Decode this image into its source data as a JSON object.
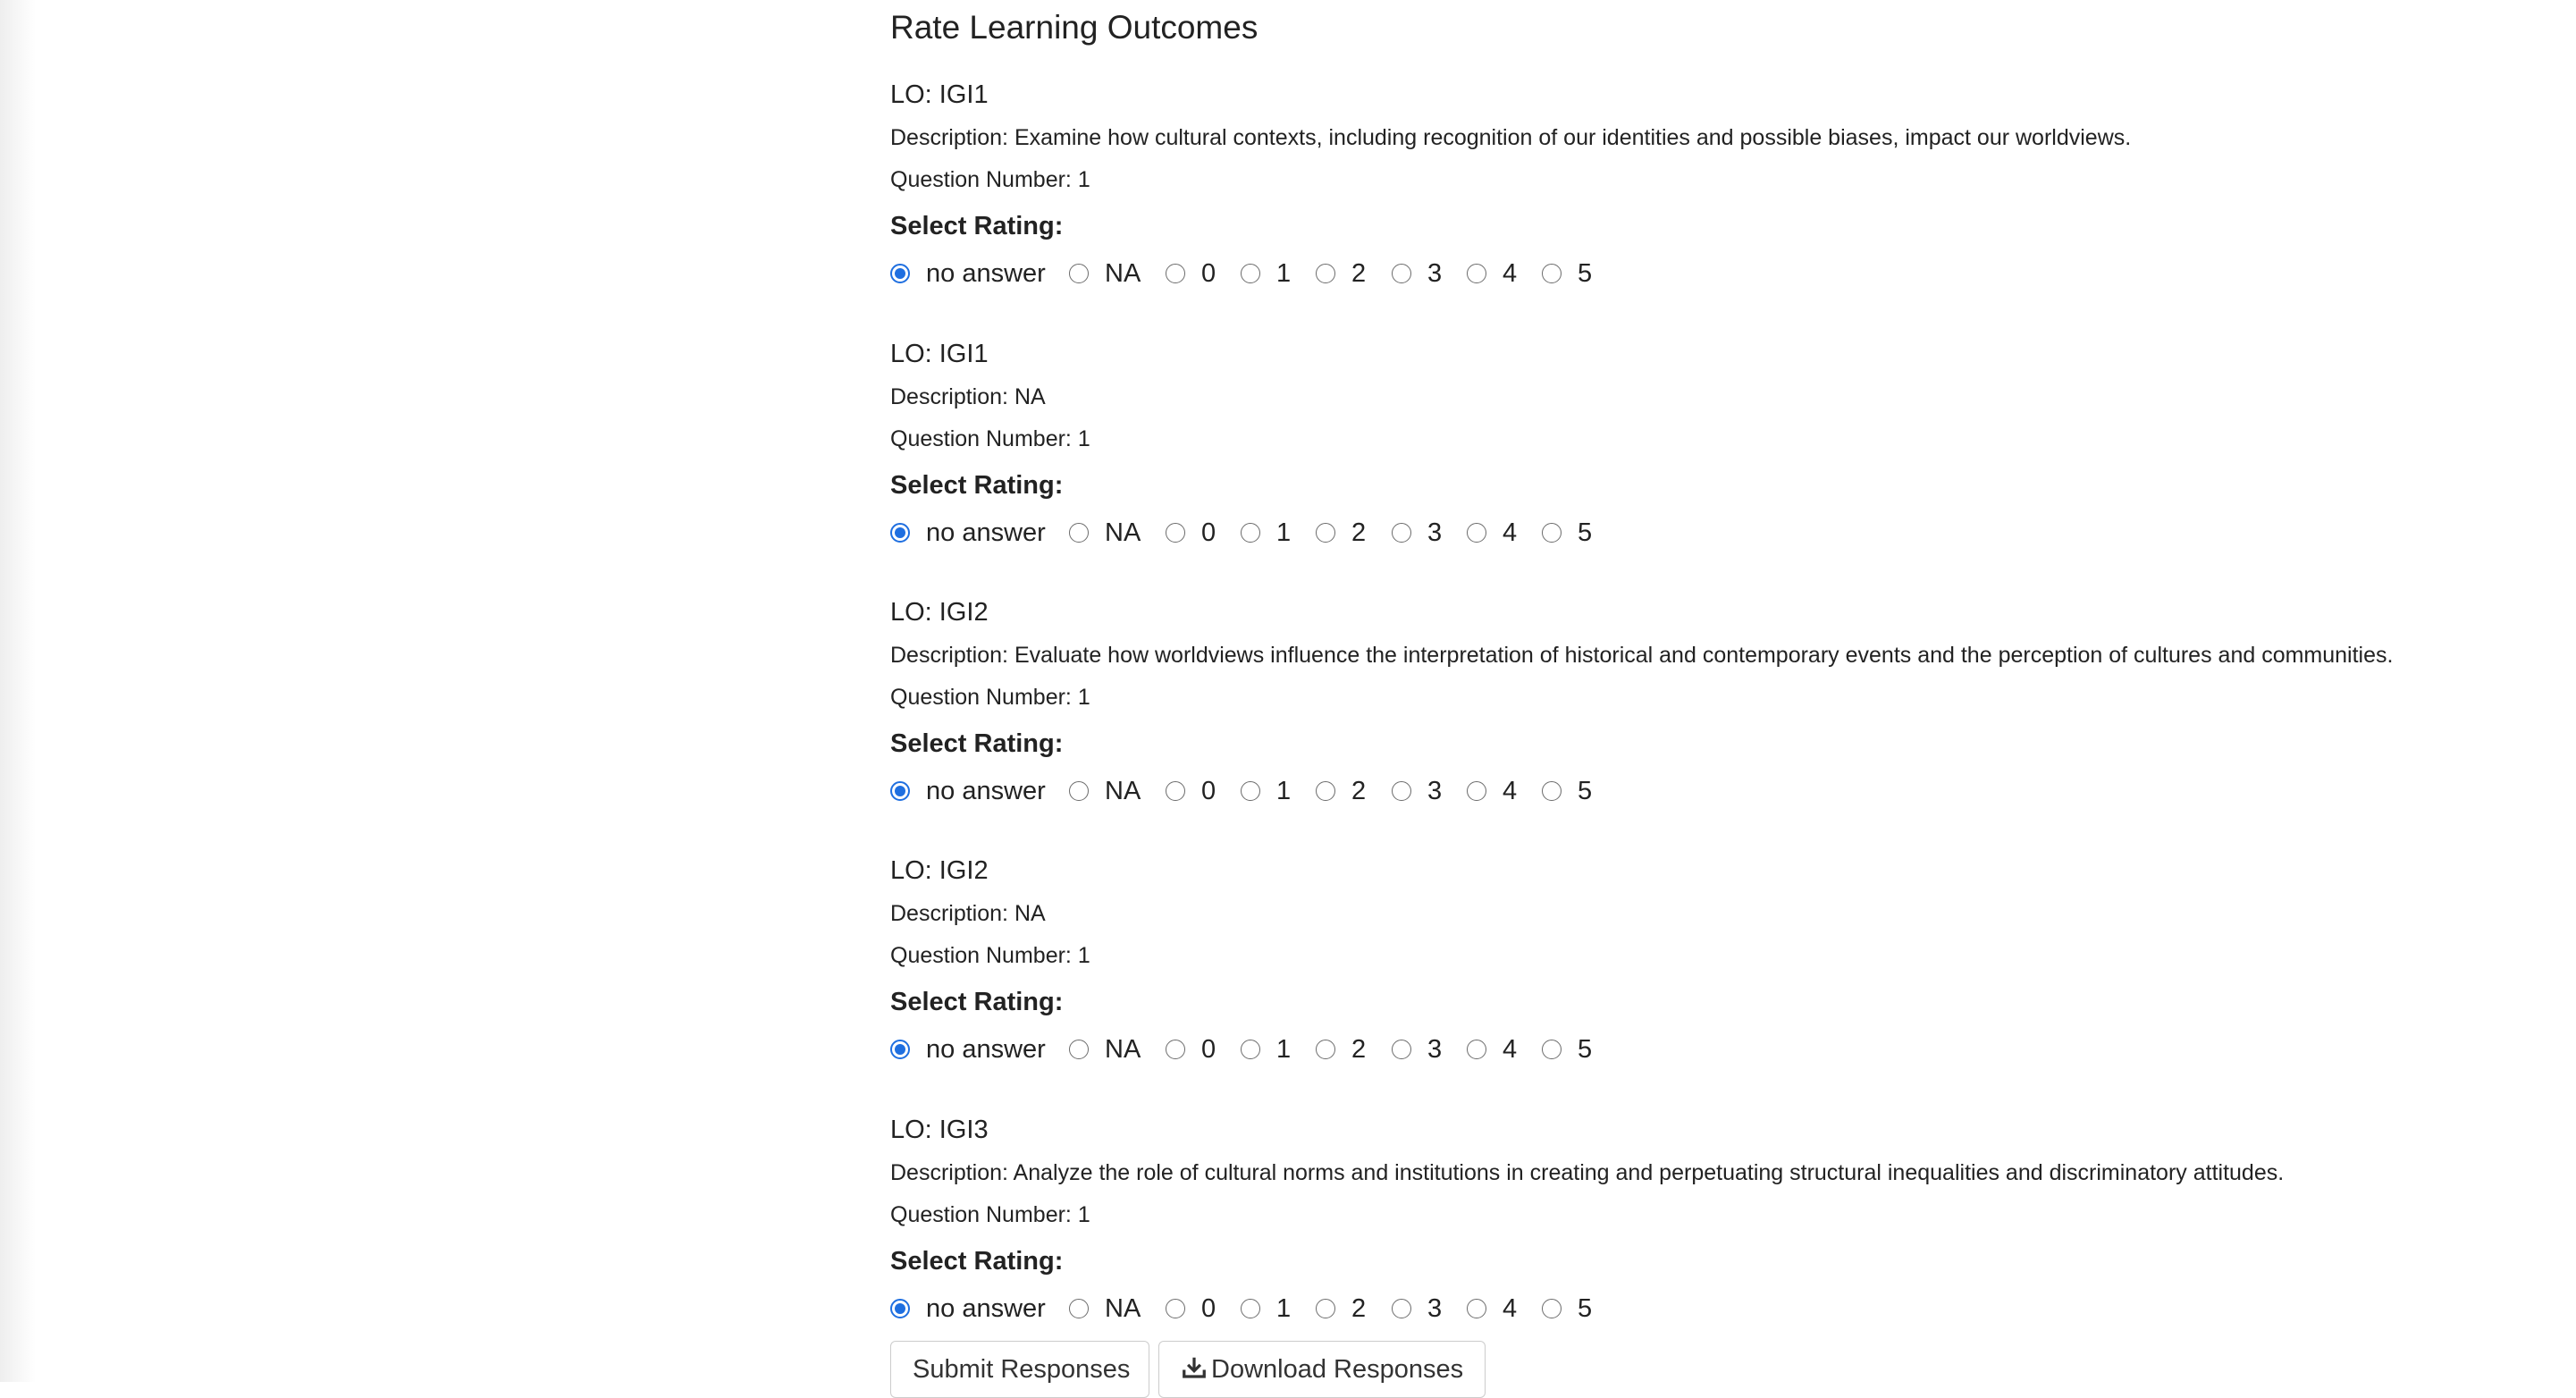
{
  "page": {
    "title": "Rate Learning Outcomes"
  },
  "rating_options": [
    "no answer",
    "NA",
    "0",
    "1",
    "2",
    "3",
    "4",
    "5"
  ],
  "selected_option": "no answer",
  "outcomes": [
    {
      "lo": "LO: IGI1",
      "description": "Description: Examine how cultural contexts, including recognition of our identities and possible biases, impact our worldviews.",
      "question": "Question Number: 1",
      "select_label": "Select Rating:"
    },
    {
      "lo": "LO: IGI1",
      "description": "Description: NA",
      "question": "Question Number: 1",
      "select_label": "Select Rating:"
    },
    {
      "lo": "LO: IGI2",
      "description": "Description: Evaluate how worldviews influence the interpretation of historical and contemporary events and the perception of cultures and communities.",
      "question": "Question Number: 1",
      "select_label": "Select Rating:"
    },
    {
      "lo": "LO: IGI2",
      "description": "Description: NA",
      "question": "Question Number: 1",
      "select_label": "Select Rating:"
    },
    {
      "lo": "LO: IGI3",
      "description": "Description: Analyze the role of cultural norms and institutions in creating and perpetuating structural inequalities and discriminatory attitudes.",
      "question": "Question Number: 1",
      "select_label": "Select Rating:"
    }
  ],
  "buttons": {
    "submit_label": "Submit Responses",
    "download_label": "Download Responses",
    "download_icon": "download-icon"
  },
  "colors": {
    "radio_selected": "#1f6fe0",
    "text": "#222222"
  }
}
